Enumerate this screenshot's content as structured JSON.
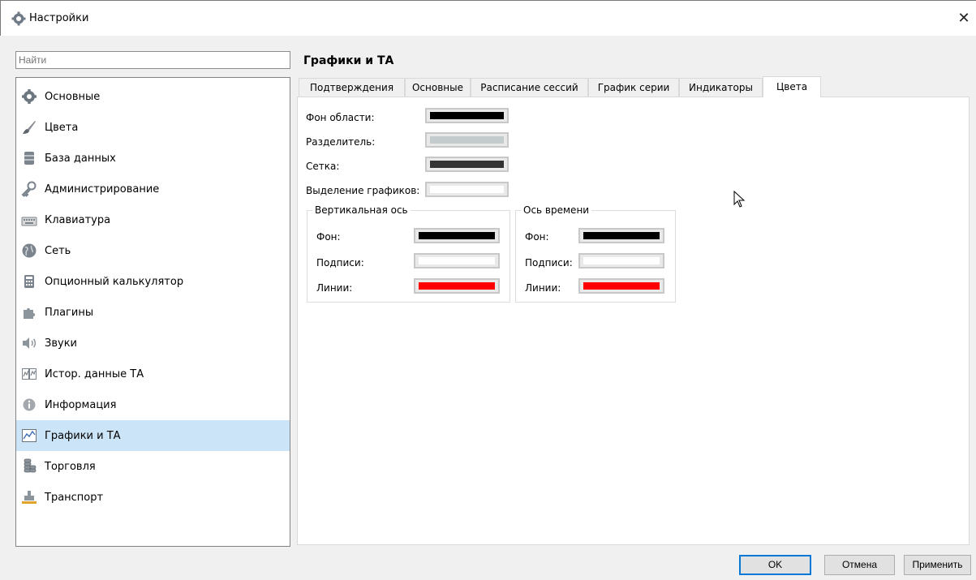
{
  "window": {
    "title": "Настройки",
    "close_glyph": "✕"
  },
  "search": {
    "placeholder": "Найти",
    "value": ""
  },
  "sidebar": {
    "items": [
      {
        "label": "Основные",
        "icon": "gear-icon"
      },
      {
        "label": "Цвета",
        "icon": "brush-icon"
      },
      {
        "label": "База данных",
        "icon": "database-icon"
      },
      {
        "label": "Администрирование",
        "icon": "key-icon"
      },
      {
        "label": "Клавиатура",
        "icon": "keyboard-icon"
      },
      {
        "label": "Сеть",
        "icon": "globe-icon"
      },
      {
        "label": "Опционный калькулятор",
        "icon": "calculator-icon"
      },
      {
        "label": "Плагины",
        "icon": "puzzle-icon"
      },
      {
        "label": "Звуки",
        "icon": "speaker-icon"
      },
      {
        "label": "Истор. данные ТА",
        "icon": "history-chart-icon"
      },
      {
        "label": "Информация",
        "icon": "info-icon"
      },
      {
        "label": "Графики и ТА",
        "icon": "line-chart-icon",
        "selected": true
      },
      {
        "label": "Торговля",
        "icon": "coins-icon"
      },
      {
        "label": "Транспорт",
        "icon": "transport-icon"
      }
    ],
    "selected_color": "#cce4f7"
  },
  "main": {
    "title": "Графики и ТА",
    "tabs": [
      {
        "label": "Подтверждения"
      },
      {
        "label": "Основные"
      },
      {
        "label": "Расписание сессий"
      },
      {
        "label": "График серии"
      },
      {
        "label": "Индикаторы"
      },
      {
        "label": "Цвета",
        "active": true
      }
    ],
    "colors": [
      {
        "label": "Фон области:",
        "color": "#000000"
      },
      {
        "label": "Разделитель:",
        "color": "#c3cbcc"
      },
      {
        "label": "Сетка:",
        "color": "#333333"
      },
      {
        "label": "Выделение графиков:",
        "color": "#ffffff"
      }
    ],
    "vertical_axis": {
      "title": "Вертикальная ось",
      "rows": [
        {
          "label": "Фон:",
          "color": "#000000"
        },
        {
          "label": "Подписи:",
          "color": "#ffffff"
        },
        {
          "label": "Линии:",
          "color": "#ff0000"
        }
      ]
    },
    "time_axis": {
      "title": "Ось времени",
      "rows": [
        {
          "label": "Фон:",
          "color": "#000000"
        },
        {
          "label": "Подписи:",
          "color": "#ffffff"
        },
        {
          "label": "Линии:",
          "color": "#ff0000"
        }
      ]
    }
  },
  "footer": {
    "ok_label": "OK",
    "cancel_label": "Отмена",
    "apply_label": "Применить"
  }
}
